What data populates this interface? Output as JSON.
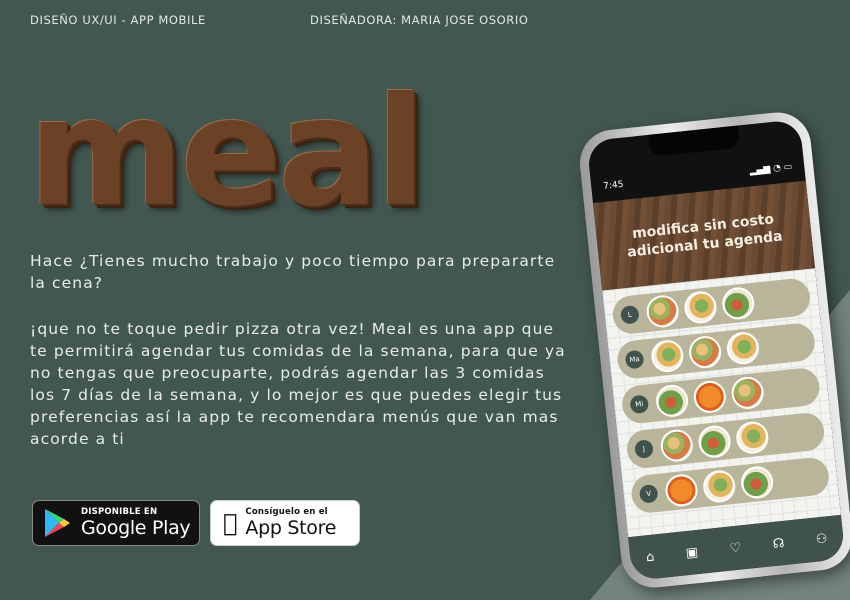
{
  "header": {
    "left": "DISEÑO UX/UI - APP MOBILE",
    "right": "DISEÑADORA:  MARIA JOSE OSORIO"
  },
  "logo": "meal",
  "description": {
    "p1": "Hace ¿Tienes mucho trabajo y poco tiempo para prepararte la cena?",
    "p2": "¡que no te toque pedir pizza otra vez! Meal es una app que te permitirá agendar tus comidas de la semana, para que ya no tengas que preocuparte, podrás agendar las 3 comidas los 7 días de la semana, y lo mejor es que puedes elegir tus preferencias así la app te recomendara menús que van mas acorde a ti"
  },
  "stores": {
    "google_small": "DISPONIBLE EN",
    "google_big": "Google Play",
    "apple_small": "Consíguelo en el",
    "apple_big": "App Store"
  },
  "phone": {
    "time": "7:45",
    "title": "modifica sin costo adicional tu agenda",
    "days": [
      "L",
      "Ma",
      "Mi",
      "J",
      "V"
    ],
    "tab_icons": [
      "home-icon",
      "calendar-icon",
      "heart-icon",
      "support-icon",
      "user-icon"
    ]
  },
  "colors": {
    "background": "#435751",
    "wood": "#6B4226",
    "row": "#B9B59A",
    "badge": "#3F524C"
  }
}
